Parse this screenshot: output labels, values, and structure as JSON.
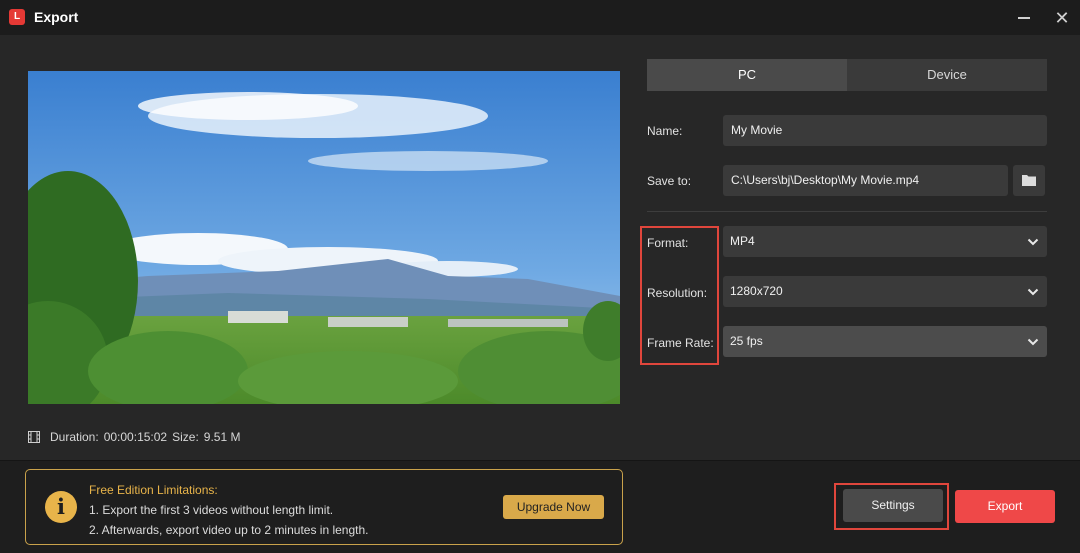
{
  "window": {
    "title": "Export",
    "logo_text": "L"
  },
  "preview": {
    "description_icon": "film-icon"
  },
  "info": {
    "duration_label": "Duration:",
    "duration_value": "00:00:15:02",
    "size_label": "Size:",
    "size_value": "9.51 M"
  },
  "tabs": [
    {
      "label": "PC",
      "active": true
    },
    {
      "label": "Device",
      "active": false
    }
  ],
  "form": {
    "name_label": "Name:",
    "name_value": "My Movie",
    "save_label": "Save to:",
    "save_value": "C:\\Users\\bj\\Desktop\\My Movie.mp4",
    "format_label": "Format:",
    "format_value": "MP4",
    "resolution_label": "Resolution:",
    "resolution_value": "1280x720",
    "framerate_label": "Frame Rate:",
    "framerate_value": "25 fps"
  },
  "limitations": {
    "title": "Free Edition Limitations:",
    "line1": "1. Export the first 3 videos without length limit.",
    "line2": "2. Afterwards, export video up to 2 minutes in length.",
    "upgrade_label": "Upgrade Now"
  },
  "actions": {
    "settings_label": "Settings",
    "export_label": "Export"
  },
  "colors": {
    "accent": "#ef4848",
    "warning": "#e8b44a",
    "highlight": "#e0463c"
  }
}
